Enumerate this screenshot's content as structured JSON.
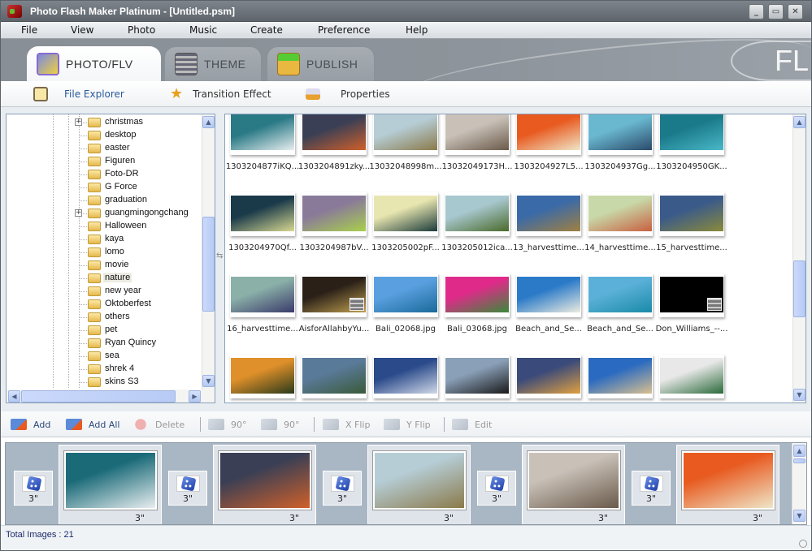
{
  "window": {
    "title": "Photo Flash Maker Platinum - [Untitled.psm]",
    "controls": [
      "minimize",
      "maximize",
      "close"
    ]
  },
  "menu": [
    "File",
    "View",
    "Photo",
    "Music",
    "Create",
    "Preference",
    "Help"
  ],
  "banner": {
    "logo_text": "FL"
  },
  "tabs": [
    {
      "label": "PHOTO/FLV",
      "active": true
    },
    {
      "label": "THEME",
      "active": false
    },
    {
      "label": "PUBLISH",
      "active": false
    }
  ],
  "subnav": [
    {
      "label": "File Explorer",
      "active": true
    },
    {
      "label": "Transition Effect",
      "active": false
    },
    {
      "label": "Properties",
      "active": false
    }
  ],
  "tree": {
    "folders": [
      {
        "name": "christmas",
        "expandable": true
      },
      {
        "name": "desktop",
        "expandable": false
      },
      {
        "name": "easter",
        "expandable": false
      },
      {
        "name": "Figuren",
        "expandable": false
      },
      {
        "name": "Foto-DR",
        "expandable": false
      },
      {
        "name": "G Force",
        "expandable": false
      },
      {
        "name": "graduation",
        "expandable": false
      },
      {
        "name": "guangmingongchang",
        "expandable": true
      },
      {
        "name": "Halloween",
        "expandable": false
      },
      {
        "name": "kaya",
        "expandable": false
      },
      {
        "name": "lomo",
        "expandable": false
      },
      {
        "name": "movie",
        "expandable": false
      },
      {
        "name": "nature",
        "expandable": false,
        "selected": true
      },
      {
        "name": "new year",
        "expandable": false
      },
      {
        "name": "Oktoberfest",
        "expandable": false
      },
      {
        "name": "others",
        "expandable": false
      },
      {
        "name": "pet",
        "expandable": false
      },
      {
        "name": "Ryan Quincy",
        "expandable": false
      },
      {
        "name": "sea",
        "expandable": false
      },
      {
        "name": "shrek 4",
        "expandable": false
      },
      {
        "name": "skins S3",
        "expandable": false
      }
    ],
    "expander_glyph": "+"
  },
  "files": [
    {
      "name": "1303204877iKQ...",
      "colors": [
        "#2a7a86",
        "#e8eef0"
      ]
    },
    {
      "name": "1303204891zky...",
      "colors": [
        "#3a3f55",
        "#d0602a"
      ]
    },
    {
      "name": "13032048998m...",
      "colors": [
        "#b6cdd6",
        "#8a7a4a"
      ]
    },
    {
      "name": "13032049173H...",
      "colors": [
        "#c9c1b8",
        "#6a5a4a"
      ]
    },
    {
      "name": "1303204927L5...",
      "colors": [
        "#e85a20",
        "#efe6c8"
      ]
    },
    {
      "name": "1303204937Gg...",
      "colors": [
        "#6ab8d0",
        "#2a4a6a"
      ]
    },
    {
      "name": "1303204950GK...",
      "colors": [
        "#1a7a8a",
        "#4ab8c8"
      ]
    },
    {
      "name": "1303204970Qf...",
      "colors": [
        "#1a3a4a",
        "#d8d890"
      ]
    },
    {
      "name": "1303204987bV...",
      "colors": [
        "#8a7a9a",
        "#a8d04a"
      ]
    },
    {
      "name": "1303205002pF...",
      "colors": [
        "#e8e6b0",
        "#1a3a3a"
      ]
    },
    {
      "name": "1303205012ica...",
      "colors": [
        "#a8c8d0",
        "#4a6a2a"
      ]
    },
    {
      "name": "13_harvesttime...",
      "colors": [
        "#3a6aa8",
        "#a08040"
      ]
    },
    {
      "name": "14_harvesttime...",
      "colors": [
        "#c8d8a8",
        "#c86040"
      ]
    },
    {
      "name": "15_harvesttime...",
      "colors": [
        "#3a5a8a",
        "#8a8a3a"
      ]
    },
    {
      "name": "16_harvesttime...",
      "colors": [
        "#8ab0a8",
        "#3a3a6a"
      ]
    },
    {
      "name": "AisforAllahbyYu...",
      "colors": [
        "#2a2018",
        "#c0a050"
      ],
      "video": true
    },
    {
      "name": "Bali_02068.jpg",
      "colors": [
        "#5aa0e0",
        "#1a6a9a"
      ]
    },
    {
      "name": "Bali_03068.jpg",
      "colors": [
        "#e02a8a",
        "#3a8a3a"
      ]
    },
    {
      "name": "Beach_and_Se...",
      "colors": [
        "#2a7ac8",
        "#ecece0"
      ]
    },
    {
      "name": "Beach_and_Se...",
      "colors": [
        "#5ab0d8",
        "#1a8aa8"
      ]
    },
    {
      "name": "Don_Williams_--...",
      "colors": [
        "#000000",
        "#000000"
      ],
      "video": true
    },
    {
      "name": "",
      "colors": [
        "#e0902a",
        "#2a3a1a"
      ]
    },
    {
      "name": "",
      "colors": [
        "#5a7a9a",
        "#3a5a3a"
      ]
    },
    {
      "name": "",
      "colors": [
        "#2a4a8a",
        "#d0d8e8"
      ]
    },
    {
      "name": "",
      "colors": [
        "#8aa0b8",
        "#1a1a1a"
      ]
    },
    {
      "name": "",
      "colors": [
        "#3a4a7a",
        "#e0a040"
      ]
    },
    {
      "name": "",
      "colors": [
        "#2a6ac0",
        "#d8c090"
      ]
    },
    {
      "name": "",
      "colors": [
        "#e8e8e8",
        "#2a6a3a"
      ]
    }
  ],
  "toolbar": [
    {
      "label": "Add",
      "enabled": true,
      "icon": "add-image-icon"
    },
    {
      "label": "Add All",
      "enabled": true,
      "icon": "add-all-icon"
    },
    {
      "label": "Delete",
      "enabled": false,
      "icon": "delete-icon"
    },
    {
      "label": "90°",
      "enabled": false,
      "icon": "rotate-left-icon"
    },
    {
      "label": "90°",
      "enabled": false,
      "icon": "rotate-right-icon"
    },
    {
      "label": "X Flip",
      "enabled": false,
      "icon": "flip-x-icon"
    },
    {
      "label": "Y Flip",
      "enabled": false,
      "icon": "flip-y-icon"
    },
    {
      "label": "Edit",
      "enabled": false,
      "icon": "edit-text-icon"
    }
  ],
  "storyboard": {
    "transitions": [
      {
        "duration": "3\""
      },
      {
        "duration": "3\""
      },
      {
        "duration": "3\""
      },
      {
        "duration": "3\""
      },
      {
        "duration": "3\""
      }
    ],
    "photos": [
      {
        "duration": "3\"",
        "colors": [
          "#1a6a78",
          "#e8eef0"
        ]
      },
      {
        "duration": "3\"",
        "colors": [
          "#3a3f55",
          "#d0602a"
        ]
      },
      {
        "duration": "3\"",
        "colors": [
          "#b6cdd6",
          "#8a7a4a"
        ]
      },
      {
        "duration": "3\"",
        "colors": [
          "#c9c1b8",
          "#6a5a4a"
        ]
      },
      {
        "duration": "3\"",
        "colors": [
          "#e85a20",
          "#efe6c8"
        ]
      }
    ]
  },
  "status": {
    "total_images": "Total Images : 21"
  }
}
